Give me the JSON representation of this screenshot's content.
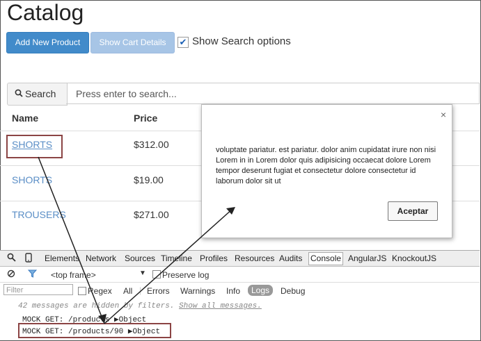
{
  "page": {
    "title": "Catalog"
  },
  "toolbar": {
    "add_label": "Add New Product",
    "cart_label": "Show Cart Details",
    "search_options_label": "Show Search options",
    "search_options_checked": true
  },
  "search": {
    "button_label": "Search",
    "placeholder": "Press enter to search..."
  },
  "table": {
    "headers": [
      "Name",
      "Price"
    ],
    "rows": [
      {
        "name": "SHORTS",
        "price": "$312.00"
      },
      {
        "name": "SHORTS",
        "price": "$19.00"
      },
      {
        "name": "TROUSERS",
        "price": "$271.00"
      }
    ]
  },
  "modal": {
    "close": "×",
    "body": "voluptate pariatur. est pariatur. dolor anim cupidatat irure non nisi Lorem in in Lorem dolor quis adipisicing occaecat dolore Lorem tempor deserunt fugiat et consectetur dolore consectetur id laborum dolor sit ut",
    "button": "Aceptar"
  },
  "devtools": {
    "tabs": [
      "Elements",
      "Network",
      "Sources",
      "Timeline",
      "Profiles",
      "Resources",
      "Audits",
      "Console",
      "AngularJS",
      "KnockoutJS"
    ],
    "active_tab": "Console",
    "frame_select": "<top frame>",
    "preserve_log": "Preserve log",
    "filter_placeholder": "Filter",
    "regex": "Regex",
    "levels": [
      "All",
      "Errors",
      "Warnings",
      "Info",
      "Logs",
      "Debug"
    ],
    "active_level": "Logs",
    "hidden_msg": "42 messages are hidden by filters.",
    "show_all": "Show all messages.",
    "logs": [
      {
        "text": "MOCK GET: /products",
        "obj": "Object"
      },
      {
        "text": "MOCK GET: /products/90",
        "obj": "Object"
      }
    ]
  },
  "colors": {
    "primary": "#428bca",
    "info": "#a7c5e6",
    "link": "#5a8ec6",
    "highlight": "#8b4444"
  }
}
